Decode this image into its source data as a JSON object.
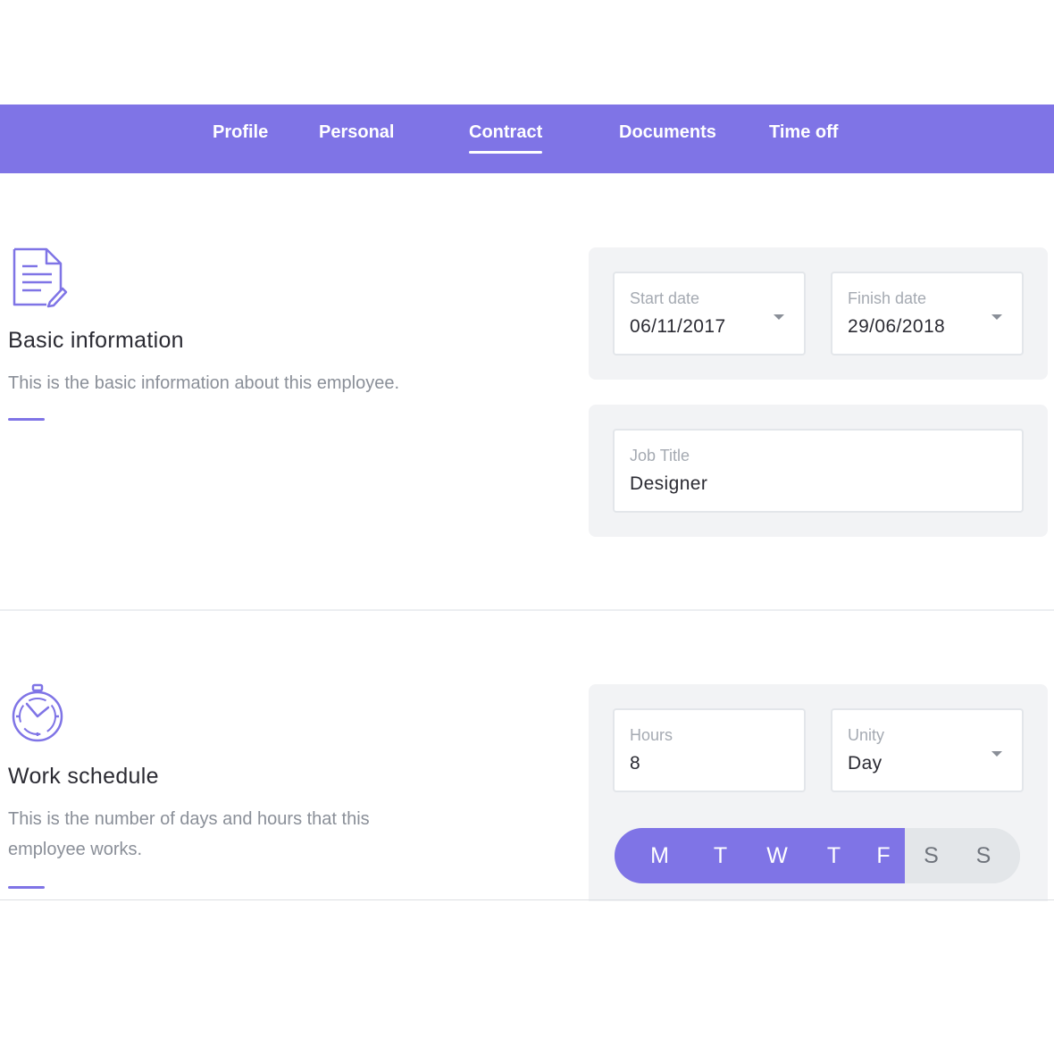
{
  "nav": {
    "tabs": [
      {
        "label": "Profile"
      },
      {
        "label": "Personal"
      },
      {
        "label": "Contract",
        "active": true
      },
      {
        "label": "Documents"
      },
      {
        "label": "Time off"
      }
    ]
  },
  "basic_info": {
    "icon": "document-edit-icon",
    "title": "Basic information",
    "description": "This is the basic information about this employee.",
    "start_date": {
      "label": "Start date",
      "value": "06/11/2017"
    },
    "finish_date": {
      "label": "Finish date",
      "value": "29/06/2018"
    },
    "job_title": {
      "label": "Job Title",
      "value": "Designer"
    }
  },
  "work_schedule": {
    "icon": "stopwatch-icon",
    "title": "Work schedule",
    "description": "This is the number of days and hours that this employee works.",
    "hours": {
      "label": "Hours",
      "value": "8"
    },
    "unity": {
      "label": "Unity",
      "value": "Day"
    },
    "days": [
      {
        "label": "M",
        "selected": true
      },
      {
        "label": "T",
        "selected": true
      },
      {
        "label": "W",
        "selected": true
      },
      {
        "label": "T",
        "selected": true
      },
      {
        "label": "F",
        "selected": true
      },
      {
        "label": "S",
        "selected": false
      },
      {
        "label": "S",
        "selected": false
      }
    ]
  },
  "colors": {
    "accent": "#7f74e6",
    "panel_bg": "#f2f3f5",
    "muted_text": "#8a8f98"
  }
}
